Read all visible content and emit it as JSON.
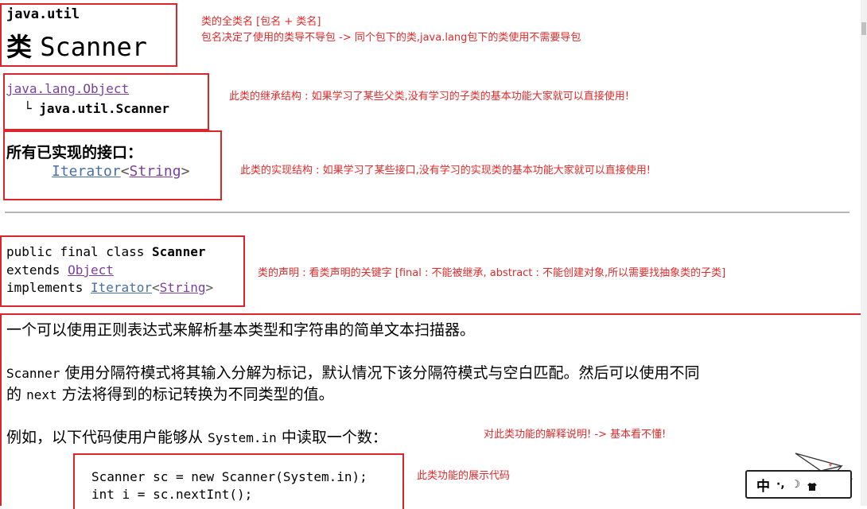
{
  "header": {
    "package": "java.util",
    "class_prefix": "类",
    "class_name": "Scanner"
  },
  "inheritance": {
    "parent": "java.lang.Object",
    "tree_branch": "└",
    "child": "java.util.Scanner"
  },
  "interfaces": {
    "heading": "所有已实现的接口：",
    "iface": "Iterator",
    "lt": "<",
    "generic": "String",
    "gt": ">"
  },
  "declaration": {
    "line1_mods": "public final class",
    "line1_name": "Scanner",
    "line2_kw": "extends",
    "line2_type": "Object",
    "line3_kw": "implements",
    "line3_iface": "Iterator",
    "lt": "<",
    "line3_generic": "String",
    "gt": ">"
  },
  "description": {
    "para1": "一个可以使用正则表达式来解析基本类型和字符串的简单文本扫描器。",
    "para2_code": "Scanner",
    "para2_text": "使用分隔符模式将其输入分解为标记，默认情况下该分隔符模式与空白匹配。然后可以使用不同",
    "para2b_lead": "的",
    "para2b_code": "next",
    "para2b_text": "方法将得到的标记转换为不同类型的值。",
    "para3_lead": "例如，以下代码使用户能够从",
    "para3_code": "System.in",
    "para3_tail": "中读取一个数："
  },
  "code_sample": {
    "line1": "Scanner sc = new Scanner(System.in);",
    "line2": "int i = sc.nextInt();"
  },
  "annotations": {
    "note1_line1": "类的全类名 [包名 + 类名]",
    "note1_line2": "包名决定了使用的类导不导包 -> 同个包下的类,java.lang包下的类使用不需要导包",
    "note2": "此类的继承结构 : 如果学习了某些父类,没有学习的子类的基本功能大家就可以直接使用!",
    "note3": "此类的实现结构 : 如果学习了某些接口,没有学习的实现类的基本功能大家就可以直接使用!",
    "note4": "类的声明 : 看类声明的关键字 [final : 不能被继承, abstract : 不能创建对象,所以需要找抽象类的子类]",
    "note5": "对此类功能的解释说明! -> 基本看不懂!",
    "note6": "此类功能的展示代码"
  },
  "ime": {
    "label": "中",
    "icons": [
      "punctuation-icon",
      "moon-icon",
      "shirt-icon"
    ],
    "glyphs": [
      "·,",
      "☽",
      "👕"
    ]
  },
  "colors": {
    "annotation_red": "#d9252b",
    "link_blue": "#4a6fa5",
    "link_purple": "#7b3f9e"
  }
}
